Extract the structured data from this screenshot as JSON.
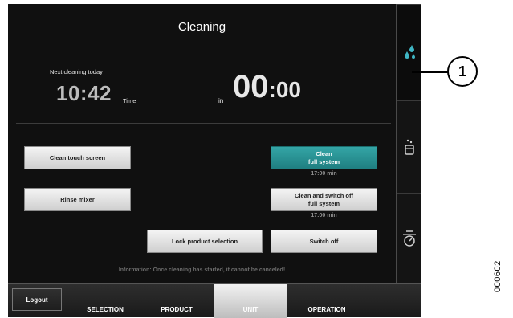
{
  "header": {
    "title": "Cleaning"
  },
  "schedule": {
    "next_label": "Next cleaning today",
    "time": "10:42",
    "time_unit": "Time",
    "in_label": "in",
    "countdown_hours": "00",
    "countdown_minutes": ":00"
  },
  "buttons": {
    "clean_touch_screen": "Clean touch screen",
    "rinse_mixer": "Rinse mixer",
    "lock_product_selection": "Lock product selection",
    "clean_full_system": "Clean\nfull system",
    "clean_full_system_duration": "17:00 min",
    "clean_switch_off": "Clean and switch off\nfull system",
    "clean_switch_off_duration": "17:00 min",
    "switch_off": "Switch off"
  },
  "info": "Information: Once cleaning has started, it cannot be canceled!",
  "sidebar": {
    "items": [
      {
        "icon": "water-drops-icon",
        "active": true
      },
      {
        "icon": "milk-container-icon",
        "active": false
      },
      {
        "icon": "timer-icon",
        "active": false
      }
    ]
  },
  "bottom_bar": {
    "logout": "Logout",
    "tabs": [
      {
        "label": "SELECTION",
        "active": false
      },
      {
        "label": "PRODUCT",
        "active": false
      },
      {
        "label": "UNIT",
        "active": true
      },
      {
        "label": "OPERATION",
        "active": false
      }
    ]
  },
  "annotation": {
    "callout_number": "1",
    "figure_id": "000602"
  },
  "colors": {
    "accent_teal": "#2a9496",
    "screen_bg": "#101010",
    "button_face": "#e2e2e2"
  }
}
